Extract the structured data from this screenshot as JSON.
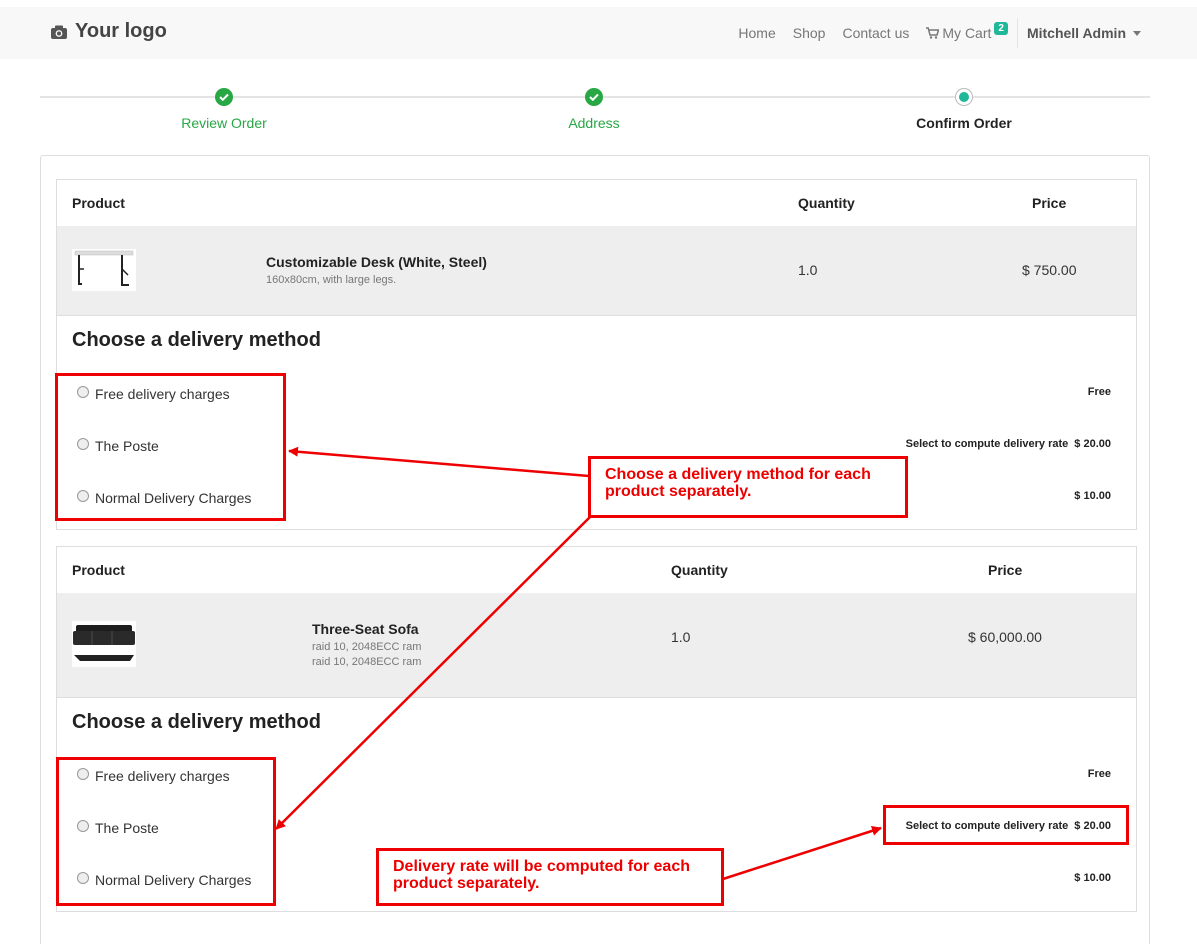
{
  "header": {
    "logo_text": "Your logo",
    "nav": [
      "Home",
      "Shop",
      "Contact us"
    ],
    "cart_label": "My Cart",
    "cart_count": "2",
    "user_name": "Mitchell Admin"
  },
  "wizard": {
    "steps": [
      {
        "label": "Review Order",
        "state": "done"
      },
      {
        "label": "Address",
        "state": "done"
      },
      {
        "label": "Confirm Order",
        "state": "current"
      }
    ]
  },
  "columns": {
    "product": "Product",
    "quantity": "Quantity",
    "price": "Price"
  },
  "orders": [
    {
      "product_name": "Customizable Desk (White, Steel)",
      "product_desc": [
        "160x80cm, with large legs."
      ],
      "quantity": "1.0",
      "price": "$ 750.00",
      "delivery_title": "Choose a delivery method",
      "methods": [
        {
          "label": "Free delivery charges",
          "hint": "",
          "rate": "Free"
        },
        {
          "label": "The Poste",
          "hint": "Select to compute delivery rate",
          "rate": "$ 20.00"
        },
        {
          "label": "Normal Delivery Charges",
          "hint": "",
          "rate": "$ 10.00"
        }
      ]
    },
    {
      "product_name": "Three-Seat Sofa",
      "product_desc": [
        "raid 10, 2048ECC ram",
        "raid 10, 2048ECC ram"
      ],
      "quantity": "1.0",
      "price": "$ 60,000.00",
      "delivery_title": "Choose a delivery method",
      "methods": [
        {
          "label": "Free delivery charges",
          "hint": "",
          "rate": "Free"
        },
        {
          "label": "The Poste",
          "hint": "Select to compute delivery rate",
          "rate": "$ 20.00"
        },
        {
          "label": "Normal Delivery Charges",
          "hint": "",
          "rate": "$ 10.00"
        }
      ]
    }
  ],
  "annotations": {
    "callout_1": "Choose a delivery method for each product separately.",
    "callout_2": "Delivery rate will be computed for each product separately.",
    "color": "#e00000"
  }
}
